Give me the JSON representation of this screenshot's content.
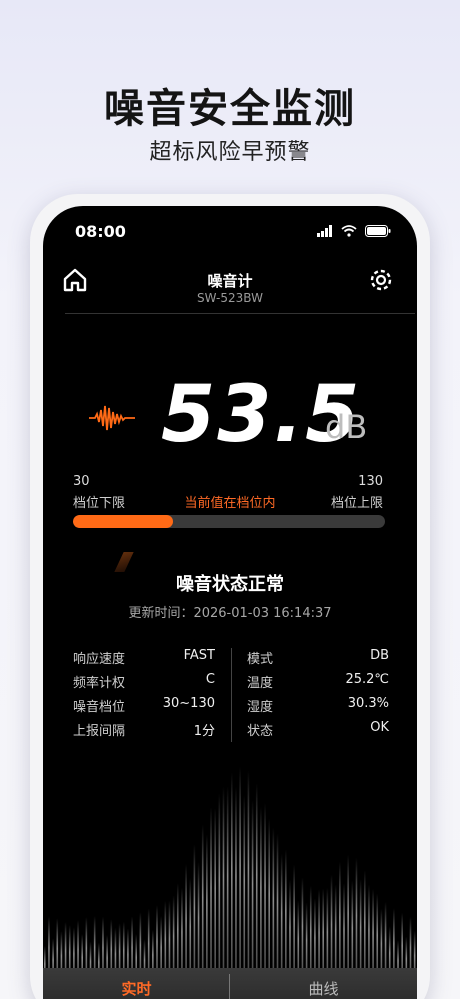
{
  "promo": {
    "title": "噪音安全监测",
    "subtitle": "超标风险早预警"
  },
  "status_bar": {
    "time": "08:00"
  },
  "header": {
    "title": "噪音计",
    "device": "SW-523BW"
  },
  "meter": {
    "value": "53.5",
    "unit": "dB"
  },
  "range": {
    "min": "30",
    "max": "130",
    "min_label": "档位下限",
    "max_label": "档位上限",
    "status": "当前值在档位内",
    "progress": 0.32
  },
  "state": {
    "title": "噪音状态正常",
    "update_time": "更新时间：2026-01-03 16:14:37"
  },
  "info_left": [
    {
      "key": "响应速度",
      "value": "FAST"
    },
    {
      "key": "频率计权",
      "value": "C"
    },
    {
      "key": "噪音档位",
      "value": "30~130"
    },
    {
      "key": "上报间隔",
      "value": "1分"
    }
  ],
  "info_right": [
    {
      "key": "模式",
      "value": "DB"
    },
    {
      "key": "温度",
      "value": "25.2℃"
    },
    {
      "key": "湿度",
      "value": "30.3%"
    },
    {
      "key": "状态",
      "value": "OK"
    }
  ],
  "tabs": {
    "realtime": "实时",
    "curve": "曲线"
  },
  "colors": {
    "accent": "#ff6a16",
    "background": "#000000"
  }
}
